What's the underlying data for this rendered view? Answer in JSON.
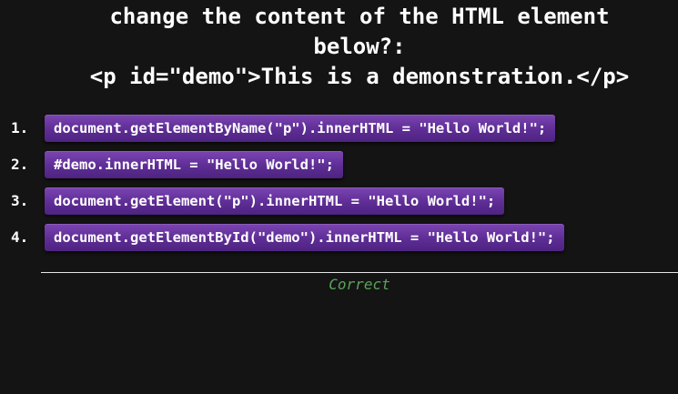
{
  "question": {
    "lines": [
      "change the content of the HTML element",
      "below?:",
      "<p id=\"demo\">This is a demonstration.</p>"
    ]
  },
  "options": [
    {
      "number": "1.",
      "code": "document.getElementByName(\"p\").innerHTML = \"Hello World!\";"
    },
    {
      "number": "2.",
      "code": "#demo.innerHTML = \"Hello World!\";"
    },
    {
      "number": "3.",
      "code": "document.getElement(\"p\").innerHTML = \"Hello World!\";"
    },
    {
      "number": "4.",
      "code": "document.getElementById(\"demo\").innerHTML = \"Hello World!\";"
    }
  ],
  "result": {
    "text": "Correct",
    "color": "#5aa35a"
  },
  "colors": {
    "background": "#141414",
    "option_button": "#5e2d95",
    "text": "#ffffff"
  }
}
